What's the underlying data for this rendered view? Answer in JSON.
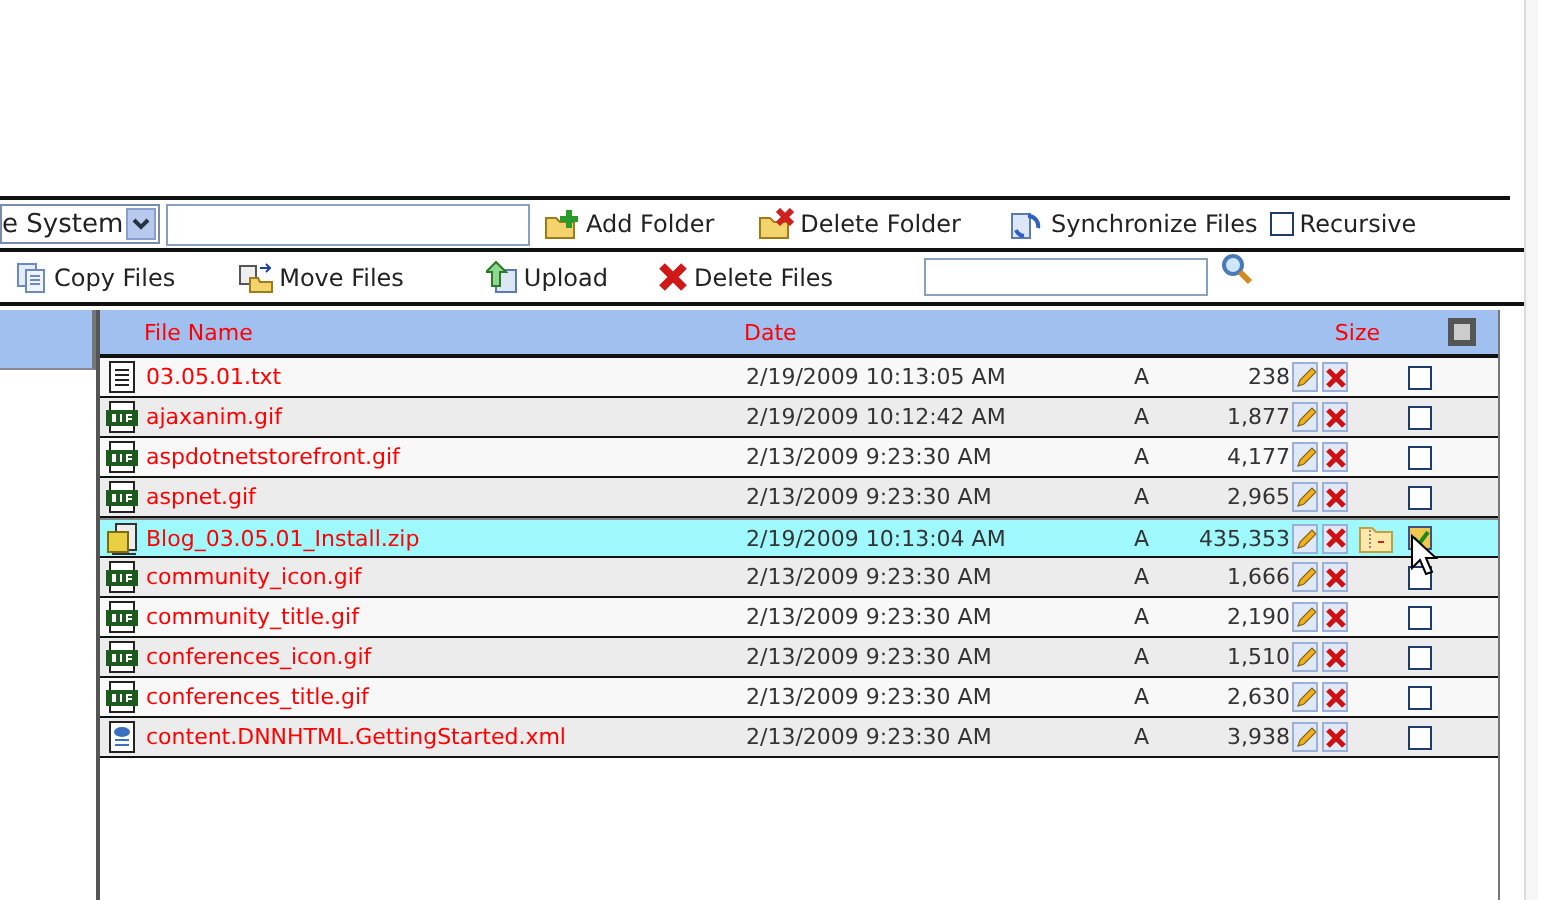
{
  "toolbar": {
    "root_select": "e System",
    "actions": [
      {
        "kind": "add-folder",
        "label": "Add Folder"
      },
      {
        "kind": "delete-folder",
        "label": "Delete Folder"
      },
      {
        "kind": "sync",
        "label": "Synchronize Files"
      }
    ],
    "recursive": {
      "label": "Recursive",
      "checked": false
    }
  },
  "file_actions": [
    {
      "kind": "copy",
      "label": "Copy Files"
    },
    {
      "kind": "move",
      "label": "Move Files"
    },
    {
      "kind": "upload",
      "label": "Upload"
    },
    {
      "kind": "delete",
      "label": "Delete Files"
    }
  ],
  "grid": {
    "columns": [
      "File Name",
      "Date",
      "Size"
    ],
    "rows": [
      {
        "kind": "txt",
        "name": "03.05.01.txt",
        "date": "2/19/2009 10:13:05 AM",
        "attr": "A",
        "size": "238",
        "unzip": false,
        "selected": false,
        "checked": false
      },
      {
        "kind": "gif",
        "name": "ajaxanim.gif",
        "date": "2/19/2009 10:12:42 AM",
        "attr": "A",
        "size": "1,877",
        "unzip": false,
        "selected": false,
        "checked": false
      },
      {
        "kind": "gif",
        "name": "aspdotnetstorefront.gif",
        "date": "2/13/2009 9:23:30 AM",
        "attr": "A",
        "size": "4,177",
        "unzip": false,
        "selected": false,
        "checked": false
      },
      {
        "kind": "gif",
        "name": "aspnet.gif",
        "date": "2/13/2009 9:23:30 AM",
        "attr": "A",
        "size": "2,965",
        "unzip": false,
        "selected": false,
        "checked": false
      },
      {
        "kind": "zip",
        "name": "Blog_03.05.01_Install.zip",
        "date": "2/19/2009 10:13:04 AM",
        "attr": "A",
        "size": "435,353",
        "unzip": true,
        "selected": true,
        "checked": true
      },
      {
        "kind": "gif",
        "name": "community_icon.gif",
        "date": "2/13/2009 9:23:30 AM",
        "attr": "A",
        "size": "1,666",
        "unzip": false,
        "selected": false,
        "checked": false
      },
      {
        "kind": "gif",
        "name": "community_title.gif",
        "date": "2/13/2009 9:23:30 AM",
        "attr": "A",
        "size": "2,190",
        "unzip": false,
        "selected": false,
        "checked": false
      },
      {
        "kind": "gif",
        "name": "conferences_icon.gif",
        "date": "2/13/2009 9:23:30 AM",
        "attr": "A",
        "size": "1,510",
        "unzip": false,
        "selected": false,
        "checked": false
      },
      {
        "kind": "gif",
        "name": "conferences_title.gif",
        "date": "2/13/2009 9:23:30 AM",
        "attr": "A",
        "size": "2,630",
        "unzip": false,
        "selected": false,
        "checked": false
      },
      {
        "kind": "xml",
        "name": "content.DNNHTML.GettingStarted.xml",
        "date": "2/13/2009 9:23:30 AM",
        "attr": "A",
        "size": "3,938",
        "unzip": false,
        "selected": false,
        "checked": false
      }
    ]
  }
}
